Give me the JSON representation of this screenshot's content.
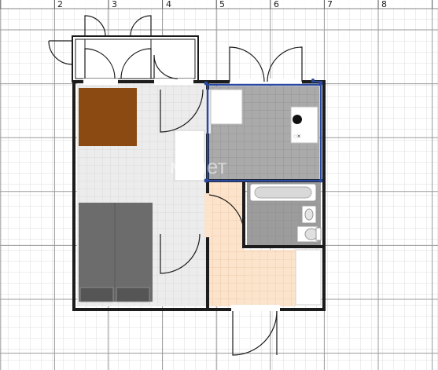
{
  "ruler": {
    "marks": [
      "2",
      "3",
      "4",
      "5",
      "6",
      "7",
      "8"
    ]
  },
  "watermark": {
    "text": "молет"
  },
  "colors": {
    "grid_minor": "#dcdcdc",
    "grid_major": "#9a9a9a",
    "wall": "#1c1c1c",
    "kitchen_floor": "#aaaaaa",
    "bath_floor": "#9c9c9c",
    "hall_floor": "#fbe3cc",
    "room_floor": "#ececec",
    "wardrobe": "#8b4a12",
    "bed": "#6c6c6c",
    "selection": "#2a4aa0"
  },
  "rooms": [
    {
      "name": "living-room",
      "floor": "room_floor"
    },
    {
      "name": "kitchen",
      "floor": "kitchen_floor"
    },
    {
      "name": "bathroom",
      "floor": "bath_floor"
    },
    {
      "name": "hallway",
      "floor": "hall_floor"
    }
  ],
  "furniture": [
    "wardrobe",
    "bed",
    "bathtub",
    "washbasin",
    "toilet",
    "cooker",
    "sink",
    "fridge"
  ]
}
